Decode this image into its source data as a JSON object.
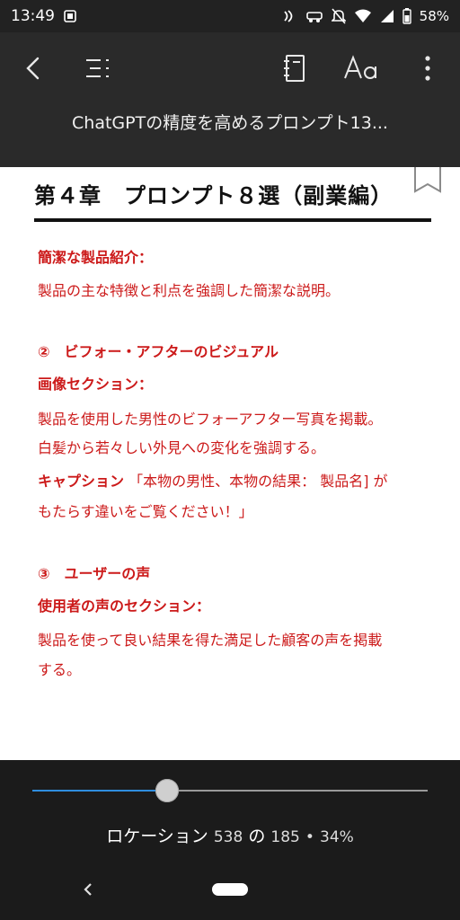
{
  "status_bar": {
    "time": "13:49",
    "battery": "58%"
  },
  "toolbar": {
    "title": "ChatGPTの精度を高めるプロンプト13..."
  },
  "content": {
    "chapter_heading": "第４章　プロンプト８選（副業編）",
    "lines": [
      {
        "text": "簡潔な製品紹介：",
        "bold": true
      },
      {
        "text": "製品の主な特徴と利点を強調した簡潔な説明。",
        "bold": false
      },
      {
        "text": "②　ビフォー・アフターのビジュアル",
        "bold": true
      },
      {
        "text": "画像セクション：",
        "bold": true
      },
      {
        "text": "製品を使用した男性のビフォーアフター写真を掲載。",
        "bold": false
      },
      {
        "text": "白髪から若々しい外見への変化を強調する。",
        "bold": false
      },
      {
        "caption_label": "キャプション",
        "caption_text": "「本物の男性、本物の結果： 製品名] が"
      },
      {
        "text": "もたらす違いをご覧ください！」",
        "bold": false
      },
      {
        "text": "③　ユーザーの声",
        "bold": true
      },
      {
        "text": "使用者の声のセクション：",
        "bold": true
      },
      {
        "text": "製品を使って良い結果を得た満足した顧客の声を掲載",
        "bold": false
      },
      {
        "text": "する。",
        "bold": false
      }
    ]
  },
  "progress": {
    "fraction": 0.34,
    "location_label": "ロケーション",
    "current": "538",
    "of": "の",
    "total": "185",
    "sep": "•",
    "percent": "34%"
  },
  "colors": {
    "accent": "#2f8ddf",
    "text_red": "#cc1a1a"
  }
}
